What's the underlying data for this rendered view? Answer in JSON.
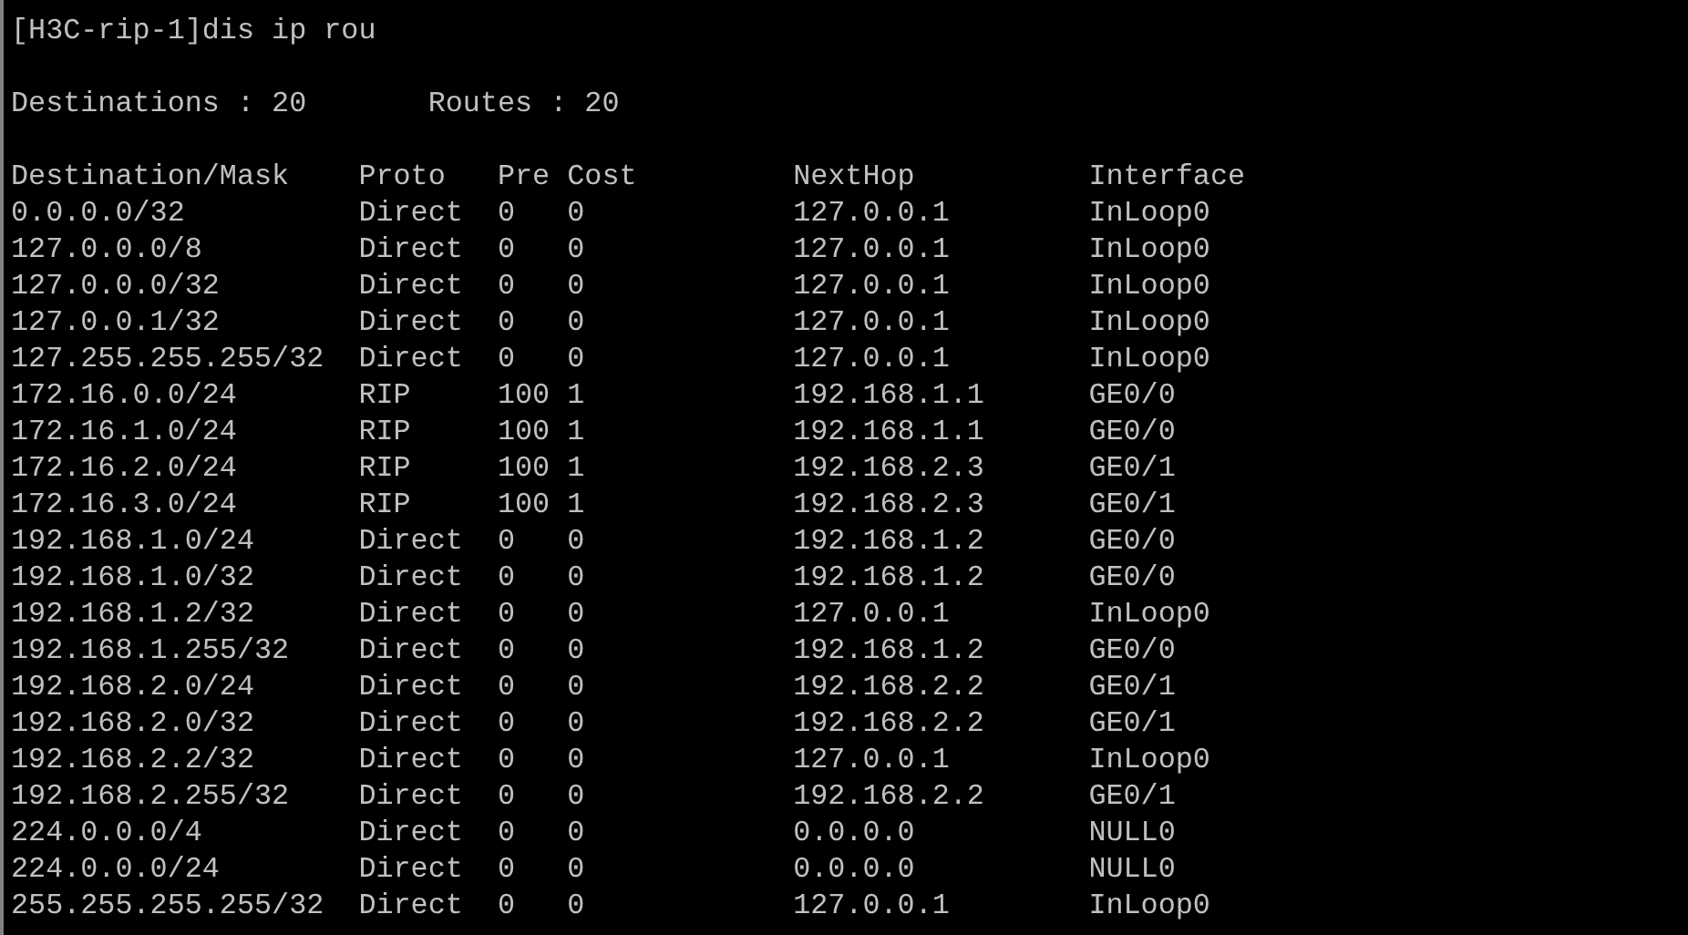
{
  "command_line": "[H3C-rip-1]dis ip rou",
  "summary": [
    {
      "label": "Destinations : 20"
    },
    {
      "label": "Routes : 20"
    }
  ],
  "table": {
    "columns": [
      "Destination/Mask",
      "Proto",
      "Pre",
      "Cost",
      "NextHop",
      "Interface"
    ],
    "rows": [
      [
        "0.0.0.0/32",
        "Direct",
        "0",
        "0",
        "127.0.0.1",
        "InLoop0"
      ],
      [
        "127.0.0.0/8",
        "Direct",
        "0",
        "0",
        "127.0.0.1",
        "InLoop0"
      ],
      [
        "127.0.0.0/32",
        "Direct",
        "0",
        "0",
        "127.0.0.1",
        "InLoop0"
      ],
      [
        "127.0.0.1/32",
        "Direct",
        "0",
        "0",
        "127.0.0.1",
        "InLoop0"
      ],
      [
        "127.255.255.255/32",
        "Direct",
        "0",
        "0",
        "127.0.0.1",
        "InLoop0"
      ],
      [
        "172.16.0.0/24",
        "RIP",
        "100",
        "1",
        "192.168.1.1",
        "GE0/0"
      ],
      [
        "172.16.1.0/24",
        "RIP",
        "100",
        "1",
        "192.168.1.1",
        "GE0/0"
      ],
      [
        "172.16.2.0/24",
        "RIP",
        "100",
        "1",
        "192.168.2.3",
        "GE0/1"
      ],
      [
        "172.16.3.0/24",
        "RIP",
        "100",
        "1",
        "192.168.2.3",
        "GE0/1"
      ],
      [
        "192.168.1.0/24",
        "Direct",
        "0",
        "0",
        "192.168.1.2",
        "GE0/0"
      ],
      [
        "192.168.1.0/32",
        "Direct",
        "0",
        "0",
        "192.168.1.2",
        "GE0/0"
      ],
      [
        "192.168.1.2/32",
        "Direct",
        "0",
        "0",
        "127.0.0.1",
        "InLoop0"
      ],
      [
        "192.168.1.255/32",
        "Direct",
        "0",
        "0",
        "192.168.1.2",
        "GE0/0"
      ],
      [
        "192.168.2.0/24",
        "Direct",
        "0",
        "0",
        "192.168.2.2",
        "GE0/1"
      ],
      [
        "192.168.2.0/32",
        "Direct",
        "0",
        "0",
        "192.168.2.2",
        "GE0/1"
      ],
      [
        "192.168.2.2/32",
        "Direct",
        "0",
        "0",
        "127.0.0.1",
        "InLoop0"
      ],
      [
        "192.168.2.255/32",
        "Direct",
        "0",
        "0",
        "192.168.2.2",
        "GE0/1"
      ],
      [
        "224.0.0.0/4",
        "Direct",
        "0",
        "0",
        "0.0.0.0",
        "NULL0"
      ],
      [
        "224.0.0.0/24",
        "Direct",
        "0",
        "0",
        "0.0.0.0",
        "NULL0"
      ],
      [
        "255.255.255.255/32",
        "Direct",
        "0",
        "0",
        "127.0.0.1",
        "InLoop0"
      ]
    ]
  }
}
